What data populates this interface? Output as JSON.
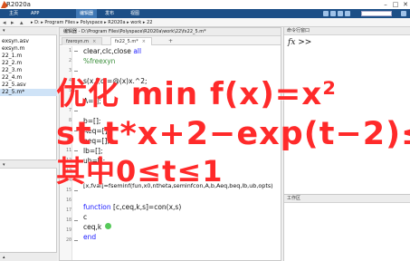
{
  "window": {
    "title": "R2020a"
  },
  "ribbon": {
    "tabs": [
      "主页",
      "APP",
      "编辑器",
      "发布",
      "视图"
    ],
    "active_tab": "编辑器"
  },
  "address": {
    "back": "◂",
    "forward": "▸",
    "crumbs": "▸ D: ▸ Program Files ▸ Polyspace ▸ R2020a ▸ work ▸ 22"
  },
  "left_panel": {
    "files": [
      "exsyn.asv",
      "exsyn.m",
      "22_1.m",
      "22_2.m",
      "22_3.m",
      "22_4.m",
      "22_5.asv",
      "22_5.m*"
    ],
    "selected_index": 7
  },
  "editor": {
    "title": "编辑器 - D:\\Program Files\\Polyspace\\R2020a\\work\\22\\fx22_5.m*",
    "tabs": [
      {
        "label": "fzeroyn.m"
      },
      {
        "label": "fx22_5.m*"
      }
    ],
    "add_tab": "+",
    "close_tab": "×",
    "line_numbers": [
      "1",
      "2",
      "3",
      "4",
      "5",
      "6",
      "7",
      "8",
      "9",
      "10",
      "11",
      "12",
      "13",
      "14",
      "15",
      "16",
      "17",
      "18",
      "19",
      "20"
    ],
    "code_lines": {
      "l1": "clear,clc,close ",
      "l1_kw": "all",
      "l2": "%freexyn",
      "l3": "s(x,t,c)=@(x)x.^2;",
      "l4": "A=[];",
      "l5": "b=[];",
      "l6": "Aeq=[];",
      "l7": "beq=[];",
      "l8": "lb=[];",
      "l9": "ub=[];",
      "l10": "[x,fval]=fseminf(fun,x0,ntheta,seminfcon,A,b,Aeq,beq,lb,ub,opts)",
      "l12_kw": "function ",
      "l12": "[c,ceq,k,s]=con(x,s)",
      "l13": "c",
      "l14": "ceq,k",
      "l15": "end"
    }
  },
  "right_panel": {
    "command_window_title": "命令行窗口",
    "fx_prompt": "fx >>",
    "workspace_title": "工作区"
  },
  "overlay": {
    "line1": "优化 min f(x)=x²",
    "line2": "st t*x+2−exp(t−2)≤0",
    "line3": "其中0≤t≤1"
  },
  "colors": {
    "ribbon_bg": "#1c4f87",
    "overlay_text": "#ff2a2a",
    "keyword": "#1a1aff",
    "comment": "#3c8f3c"
  }
}
